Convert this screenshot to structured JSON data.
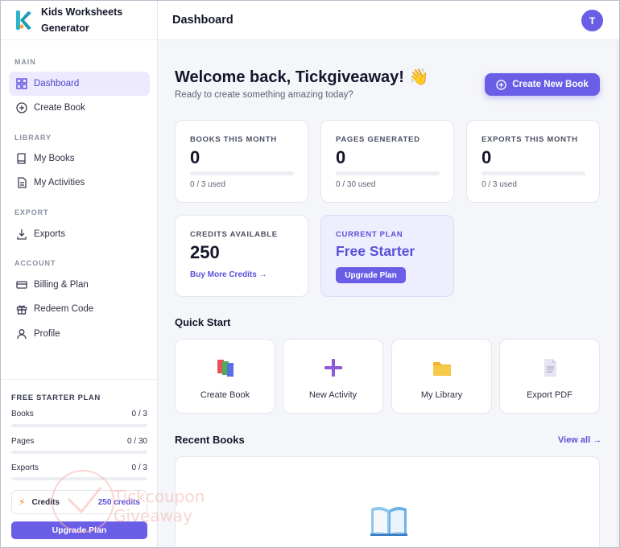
{
  "app": {
    "name": "Kids Worksheets Generator"
  },
  "header": {
    "title": "Dashboard",
    "avatar_initial": "T"
  },
  "sidebar": {
    "sections": {
      "main": "MAIN",
      "library": "LIBRARY",
      "export": "EXPORT",
      "account": "ACCOUNT"
    },
    "items": {
      "dashboard": "Dashboard",
      "create_book": "Create Book",
      "my_books": "My Books",
      "my_activities": "My Activities",
      "exports": "Exports",
      "billing": "Billing & Plan",
      "redeem": "Redeem Code",
      "profile": "Profile"
    },
    "plan": {
      "title": "FREE STARTER PLAN",
      "books_label": "Books",
      "books_value": "0 / 3",
      "pages_label": "Pages",
      "pages_value": "0 / 30",
      "exports_label": "Exports",
      "exports_value": "0 / 3",
      "credits_label": "Credits",
      "credits_value": "250 credits",
      "upgrade_label": "Upgrade Plan"
    }
  },
  "welcome": {
    "title": "Welcome back, Tickgiveaway! 👋",
    "subtitle": "Ready to create something amazing today?",
    "create_button": "Create New Book"
  },
  "stats": {
    "books": {
      "label": "BOOKS THIS MONTH",
      "value": "0",
      "used": "0 / 3 used",
      "fraction": 0
    },
    "pages": {
      "label": "PAGES GENERATED",
      "value": "0",
      "used": "0 / 30 used",
      "fraction": 0
    },
    "exports": {
      "label": "EXPORTS THIS MONTH",
      "value": "0",
      "used": "0 / 3 used",
      "fraction": 0
    },
    "credits": {
      "label": "CREDITS AVAILABLE",
      "value": "250",
      "link": "Buy More Credits →"
    },
    "plan": {
      "label": "CURRENT PLAN",
      "name": "Free Starter",
      "button": "Upgrade Plan"
    }
  },
  "quick_start": {
    "title": "Quick Start",
    "items": [
      {
        "label": "Create Book",
        "icon": "books-icon"
      },
      {
        "label": "New Activity",
        "icon": "plus-icon"
      },
      {
        "label": "My Library",
        "icon": "folder-icon"
      },
      {
        "label": "Export PDF",
        "icon": "document-icon"
      }
    ]
  },
  "recent": {
    "title": "Recent Books",
    "view_all": "View all →"
  },
  "watermark": {
    "line1": "Tickcoupon",
    "line2": "Giveaway"
  },
  "colors": {
    "accent": "#6b5ee6",
    "accent_text": "#5b4fd8",
    "active_bg": "#ede9ff"
  }
}
